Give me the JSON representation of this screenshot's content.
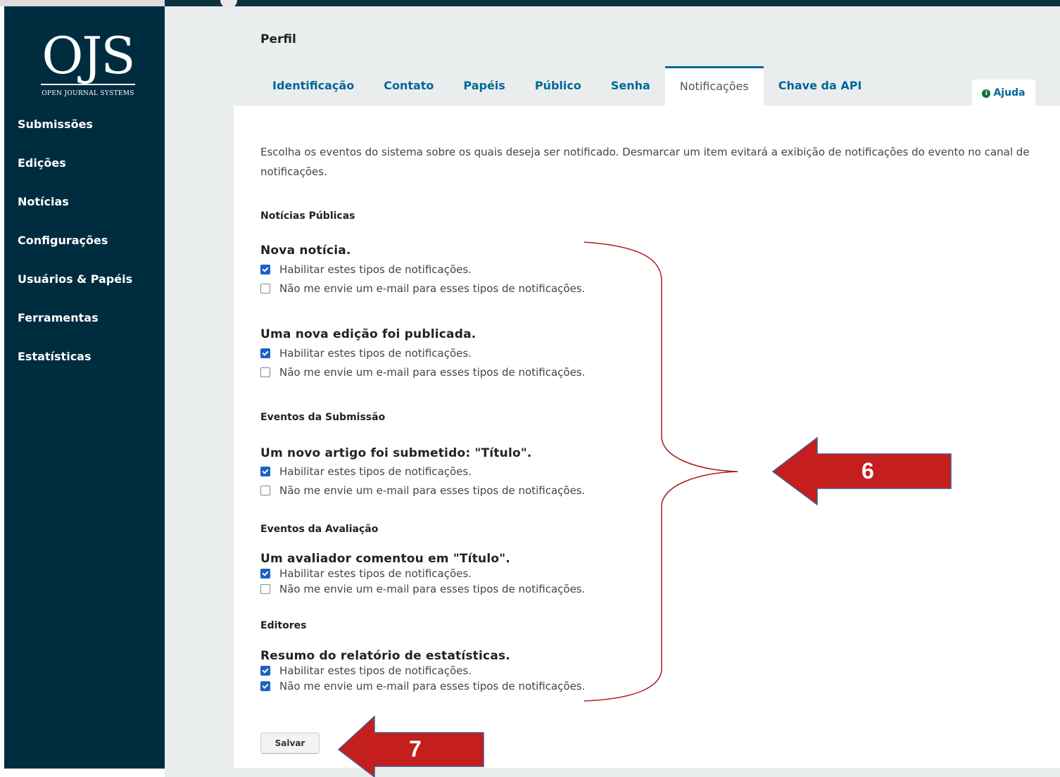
{
  "sidebar": {
    "logo_text": "OJS",
    "logo_sub": "OPEN JOURNAL SYSTEMS",
    "items": [
      {
        "label": "Submissões"
      },
      {
        "label": "Edições"
      },
      {
        "label": "Notícias"
      },
      {
        "label": "Configurações"
      },
      {
        "label": "Usuários & Papéis"
      },
      {
        "label": "Ferramentas"
      },
      {
        "label": "Estatísticas"
      }
    ]
  },
  "page": {
    "title": "Perfil",
    "help_label": "Ajuda",
    "tabs": [
      {
        "label": "Identificação"
      },
      {
        "label": "Contato"
      },
      {
        "label": "Papéis"
      },
      {
        "label": "Público"
      },
      {
        "label": "Senha"
      },
      {
        "label": "Notificações",
        "active": true
      },
      {
        "label": "Chave da API"
      }
    ],
    "description": "Escolha os eventos do sistema sobre os quais deseja ser notificado. Desmarcar um item evitará a exibição de notificações do evento no canal de notificações."
  },
  "sections": [
    {
      "heading": "Notícias Públicas"
    },
    {
      "heading": "Eventos da Submissão"
    },
    {
      "heading": "Eventos da Avaliação"
    },
    {
      "heading": "Editores"
    }
  ],
  "events": [
    {
      "title": "Nova notícia.",
      "enable": true,
      "no_email": false
    },
    {
      "title": "Uma nova edição foi publicada.",
      "enable": true,
      "no_email": false
    },
    {
      "title": "Um novo artigo foi submetido: \"Título\".",
      "enable": true,
      "no_email": false
    },
    {
      "title": "Um avaliador comentou em \"Título\".",
      "enable": true,
      "no_email": false
    },
    {
      "title": "Resumo do relatório de estatísticas.",
      "enable": true,
      "no_email": true
    }
  ],
  "options": {
    "enable_label": "Habilitar estes tipos de notificações.",
    "no_email_label": "Não me envie um e-mail para esses tipos de notificações."
  },
  "save_label": "Salvar",
  "annotations": {
    "callout_6": "6",
    "callout_7": "7",
    "arrow_color": "#c41e1e"
  }
}
